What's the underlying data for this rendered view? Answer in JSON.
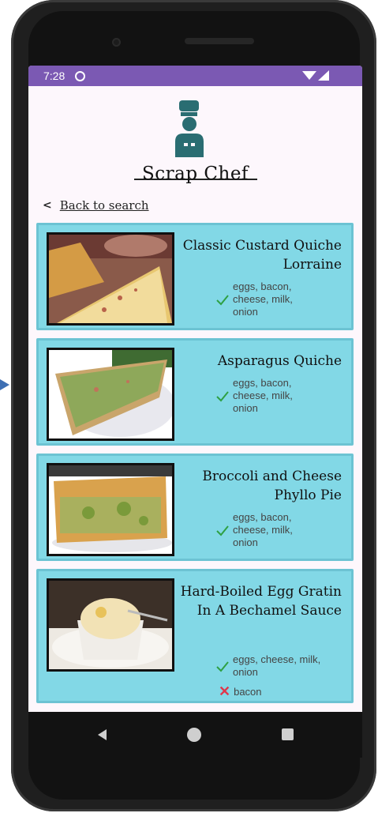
{
  "status_bar": {
    "time": "7:28"
  },
  "app": {
    "title": "Scrap Chef"
  },
  "nav": {
    "back_label": "Back to search"
  },
  "recipes": [
    {
      "title": "Classic Custard Quiche Lorraine",
      "have": "eggs, bacon, cheese, milk, onion",
      "missing": ""
    },
    {
      "title": "Asparagus Quiche",
      "have": "eggs, bacon, cheese, milk, onion",
      "missing": ""
    },
    {
      "title": "Broccoli and Cheese Phyllo Pie",
      "have": "eggs, bacon, cheese, milk, onion",
      "missing": ""
    },
    {
      "title": "Hard-Boiled Egg Gratin In A Bechamel Sauce",
      "have": "eggs, cheese, milk, onion",
      "missing": "bacon"
    }
  ],
  "icons": {
    "status": [
      "status-circle-icon",
      "wifi-icon",
      "signal-icon"
    ],
    "logo": "chef-icon",
    "back": "chevron-left-icon",
    "have": "check-icon",
    "missing": "cross-icon",
    "system_nav": [
      "nav-back-icon",
      "nav-home-icon",
      "nav-recent-icon"
    ]
  },
  "colors": {
    "status_bar": "#7b59b3",
    "card_bg": "#82d8e6",
    "check": "#2ea043",
    "cross": "#e0374b",
    "logo": "#2a6d72"
  }
}
